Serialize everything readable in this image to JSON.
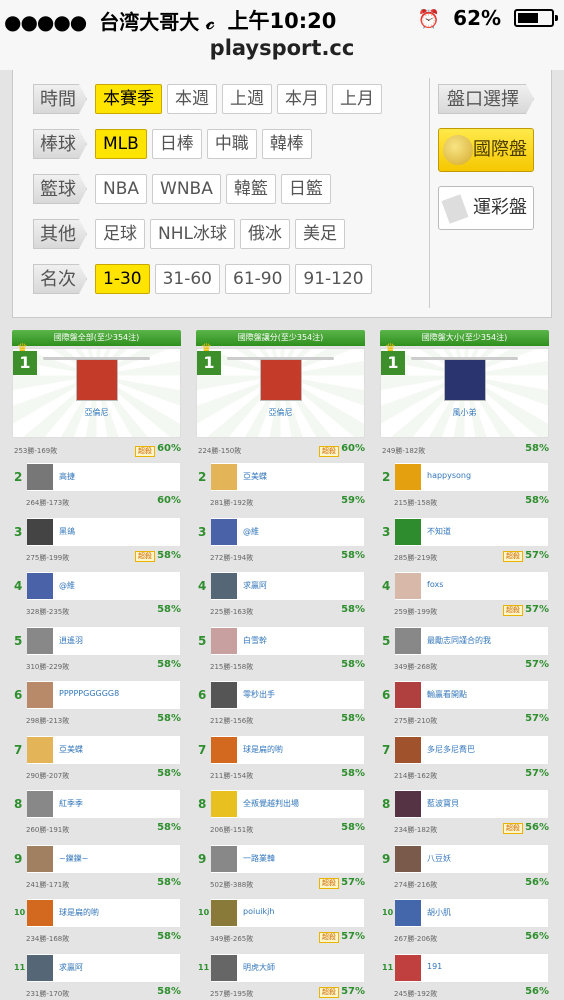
{
  "status": {
    "carrier": "台湾大哥大",
    "time": "上午10:20",
    "battery": "62%",
    "battery_level": 0.62,
    "signal_dots": "●●●●●"
  },
  "url": "playsport.cc",
  "filters": {
    "rows": [
      {
        "label": "時間",
        "options": [
          "本賽季",
          "本週",
          "上週",
          "本月",
          "上月"
        ],
        "active": 0
      },
      {
        "label": "棒球",
        "options": [
          "MLB",
          "日棒",
          "中職",
          "韓棒"
        ],
        "active": 0
      },
      {
        "label": "籃球",
        "options": [
          "NBA",
          "WNBA",
          "韓籃",
          "日籃"
        ],
        "active": -1
      },
      {
        "label": "其他",
        "options": [
          "足球",
          "NHL冰球",
          "俄冰",
          "美足"
        ],
        "active": -1
      },
      {
        "label": "名次",
        "options": [
          "1-30",
          "31-60",
          "61-90",
          "91-120"
        ],
        "active": 0
      }
    ],
    "market_label": "盤口選擇",
    "market_intl": "國際盤",
    "market_lottery": "運彩盤"
  },
  "hot_label": "超殺",
  "columns": [
    {
      "title": "國際盤全部(至少354注)",
      "first": {
        "rank": "1",
        "name": "亞倫尼",
        "record": "253勝-169敗",
        "pct": "60%",
        "hot": true,
        "color": "#c43b2a"
      },
      "entries": [
        {
          "rank": "2",
          "name": "高捷",
          "record": "264勝-173敗",
          "pct": "60%",
          "hot": false,
          "color": "#777"
        },
        {
          "rank": "3",
          "name": "黑鴿",
          "record": "275勝-199敗",
          "pct": "58%",
          "hot": true,
          "color": "#444"
        },
        {
          "rank": "4",
          "name": "@維",
          "record": "328勝-235敗",
          "pct": "58%",
          "hot": false,
          "color": "#4a63a8"
        },
        {
          "rank": "5",
          "name": "逍遙羽",
          "record": "310勝-229敗",
          "pct": "58%",
          "hot": false,
          "color": "#888"
        },
        {
          "rank": "6",
          "name": "PPPPPGGGGG8",
          "record": "298勝-213敗",
          "pct": "58%",
          "hot": false,
          "color": "#b98a6a"
        },
        {
          "rank": "7",
          "name": "亞美蝶",
          "record": "290勝-207敗",
          "pct": "58%",
          "hot": false,
          "color": "#e4b458"
        },
        {
          "rank": "8",
          "name": "紅季季",
          "record": "260勝-191敗",
          "pct": "58%",
          "hot": false,
          "color": "#888"
        },
        {
          "rank": "9",
          "name": "~鑠鑠~",
          "record": "241勝-171敗",
          "pct": "58%",
          "hot": false,
          "color": "#a08060"
        },
        {
          "rank": "10",
          "name": "球是扁的喲",
          "record": "234勝-168敗",
          "pct": "58%",
          "hot": false,
          "color": "#d2691e"
        },
        {
          "rank": "11",
          "name": "求贏阿",
          "record": "231勝-170敗",
          "pct": "58%",
          "hot": false,
          "color": "#556677"
        }
      ]
    },
    {
      "title": "國際盤讓分(至少354注)",
      "first": {
        "rank": "1",
        "name": "亞倫尼",
        "record": "224勝-150敗",
        "pct": "60%",
        "hot": true,
        "color": "#c43b2a"
      },
      "entries": [
        {
          "rank": "2",
          "name": "亞美蝶",
          "record": "281勝-192敗",
          "pct": "59%",
          "hot": false,
          "color": "#e4b458"
        },
        {
          "rank": "3",
          "name": "@維",
          "record": "272勝-194敗",
          "pct": "58%",
          "hot": false,
          "color": "#4a63a8"
        },
        {
          "rank": "4",
          "name": "求贏阿",
          "record": "225勝-163敗",
          "pct": "58%",
          "hot": false,
          "color": "#556677"
        },
        {
          "rank": "5",
          "name": "白雪幹",
          "record": "215勝-158敗",
          "pct": "58%",
          "hot": false,
          "color": "#c9a0a0"
        },
        {
          "rank": "6",
          "name": "零秒出手",
          "record": "212勝-156敗",
          "pct": "58%",
          "hot": false,
          "color": "#555"
        },
        {
          "rank": "7",
          "name": "球是扁的喲",
          "record": "211勝-154敗",
          "pct": "58%",
          "hot": false,
          "color": "#d2691e"
        },
        {
          "rank": "8",
          "name": "全叛覺越判出場",
          "record": "206勝-151敗",
          "pct": "58%",
          "hot": false,
          "color": "#e8c020"
        },
        {
          "rank": "9",
          "name": "一路業韓",
          "record": "502勝-388敗",
          "pct": "57%",
          "hot": true,
          "color": "#888"
        },
        {
          "rank": "10",
          "name": "poiuikjh",
          "record": "349勝-265敗",
          "pct": "57%",
          "hot": true,
          "color": "#8a7a3a"
        },
        {
          "rank": "11",
          "name": "明虎大師",
          "record": "257勝-195敗",
          "pct": "57%",
          "hot": true,
          "color": "#666"
        }
      ]
    },
    {
      "title": "國際盤大小(至少354注)",
      "first": {
        "rank": "1",
        "name": "風小弟",
        "record": "249勝-182敗",
        "pct": "58%",
        "hot": false,
        "color": "#2a3570"
      },
      "entries": [
        {
          "rank": "2",
          "name": "happysong",
          "record": "215勝-158敗",
          "pct": "58%",
          "hot": false,
          "color": "#e5a010"
        },
        {
          "rank": "3",
          "name": "不知道",
          "record": "285勝-219敗",
          "pct": "57%",
          "hot": true,
          "color": "#2e8b2e"
        },
        {
          "rank": "4",
          "name": "foxs",
          "record": "259勝-199敗",
          "pct": "57%",
          "hot": true,
          "color": "#d8b8a8"
        },
        {
          "rank": "5",
          "name": "最勵志同謹合的我",
          "record": "349勝-268敗",
          "pct": "57%",
          "hot": false,
          "color": "#888"
        },
        {
          "rank": "6",
          "name": "輸贏看開點",
          "record": "275勝-210敗",
          "pct": "57%",
          "hot": false,
          "color": "#b04040"
        },
        {
          "rank": "7",
          "name": "多尼多尼喬巴",
          "record": "214勝-162敗",
          "pct": "57%",
          "hot": false,
          "color": "#a0522d"
        },
        {
          "rank": "8",
          "name": "藍波寶貝",
          "record": "234勝-182敗",
          "pct": "56%",
          "hot": true,
          "color": "#553344"
        },
        {
          "rank": "9",
          "name": "八豆妖",
          "record": "274勝-216敗",
          "pct": "56%",
          "hot": false,
          "color": "#7a5a4a"
        },
        {
          "rank": "10",
          "name": "胡小肌",
          "record": "267勝-206敗",
          "pct": "56%",
          "hot": false,
          "color": "#4466aa"
        },
        {
          "rank": "11",
          "name": "191",
          "record": "245勝-192敗",
          "pct": "56%",
          "hot": false,
          "color": "#c04040"
        }
      ]
    }
  ]
}
